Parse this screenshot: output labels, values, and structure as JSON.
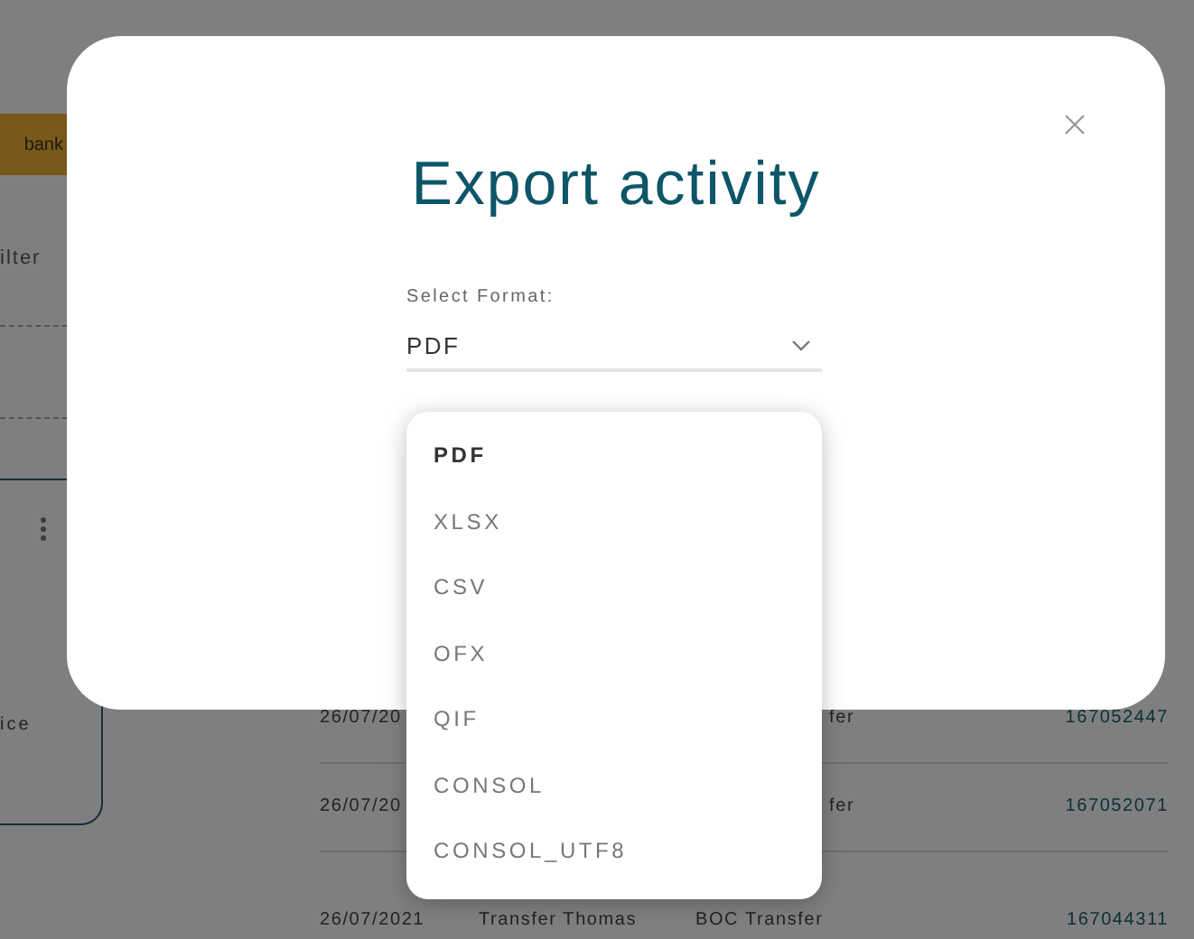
{
  "background": {
    "bank_button": "bank",
    "filter_label": "ilter",
    "card_text": "ice",
    "table_rows": [
      {
        "date": "26/07/20",
        "type": "fer",
        "reference": "167052447"
      },
      {
        "date": "26/07/20",
        "type": "fer",
        "reference": "167052071"
      },
      {
        "date": "26/07/2021",
        "description": "Transfer Thomas",
        "type": "BOC Transfer",
        "reference": "167044311"
      }
    ]
  },
  "dialog": {
    "title": "Export activity",
    "format_label": "Select Format:",
    "format_value": "PDF",
    "options": [
      {
        "label": "PDF",
        "selected": true
      },
      {
        "label": "XLSX",
        "selected": false
      },
      {
        "label": "CSV",
        "selected": false
      },
      {
        "label": "OFX",
        "selected": false
      },
      {
        "label": "QIF",
        "selected": false
      },
      {
        "label": "CONSOL",
        "selected": false
      },
      {
        "label": "CONSOL_UTF8",
        "selected": false
      }
    ]
  }
}
